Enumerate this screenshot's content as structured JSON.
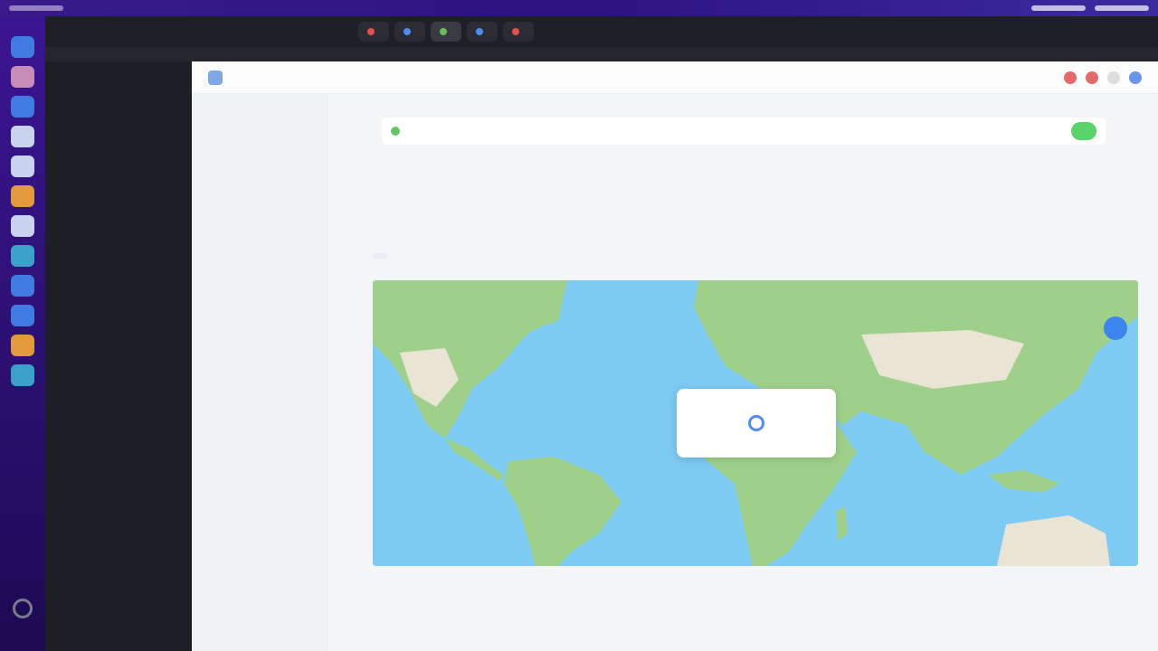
{
  "os_bar": {
    "left_text": "",
    "right_items": [
      "",
      ""
    ]
  },
  "browser": {
    "tabs": [
      {
        "label": "",
        "color": "#e25151"
      },
      {
        "label": "",
        "color": "#4c8ff0"
      },
      {
        "label": "",
        "color": "#6bbf5a"
      },
      {
        "label": "",
        "color": "#4c8ff0"
      },
      {
        "label": "",
        "color": "#e25151"
      }
    ],
    "sidebar_items": [
      "",
      "",
      "",
      "",
      ""
    ]
  },
  "app": {
    "brand": "",
    "breadcrumb": "",
    "nav": [
      "",
      "",
      "",
      "",
      "",
      "",
      "",
      "",
      "",
      ""
    ],
    "banner": {
      "badge": "",
      "message": "",
      "cta": ""
    },
    "page_title": "",
    "page_subtitle": "",
    "filters": {
      "chip": "",
      "sort": ""
    },
    "stats": [
      {
        "label": "",
        "value": "",
        "delta": "",
        "link": ""
      },
      {
        "label": "",
        "value": "",
        "delta": "",
        "link": ""
      },
      {
        "label": "",
        "value": "",
        "delta": "",
        "link": ""
      },
      {
        "label": "",
        "value": "",
        "delta": "",
        "link": ""
      }
    ]
  },
  "map": {
    "ocean_color": "#7dcaf2",
    "land_color": "#9fd08a",
    "desert_color": "#e9e4d4"
  },
  "icons": {
    "settings": "gear-icon",
    "map_pin": "map-pin-icon",
    "zoom": "zoom-button-icon"
  }
}
